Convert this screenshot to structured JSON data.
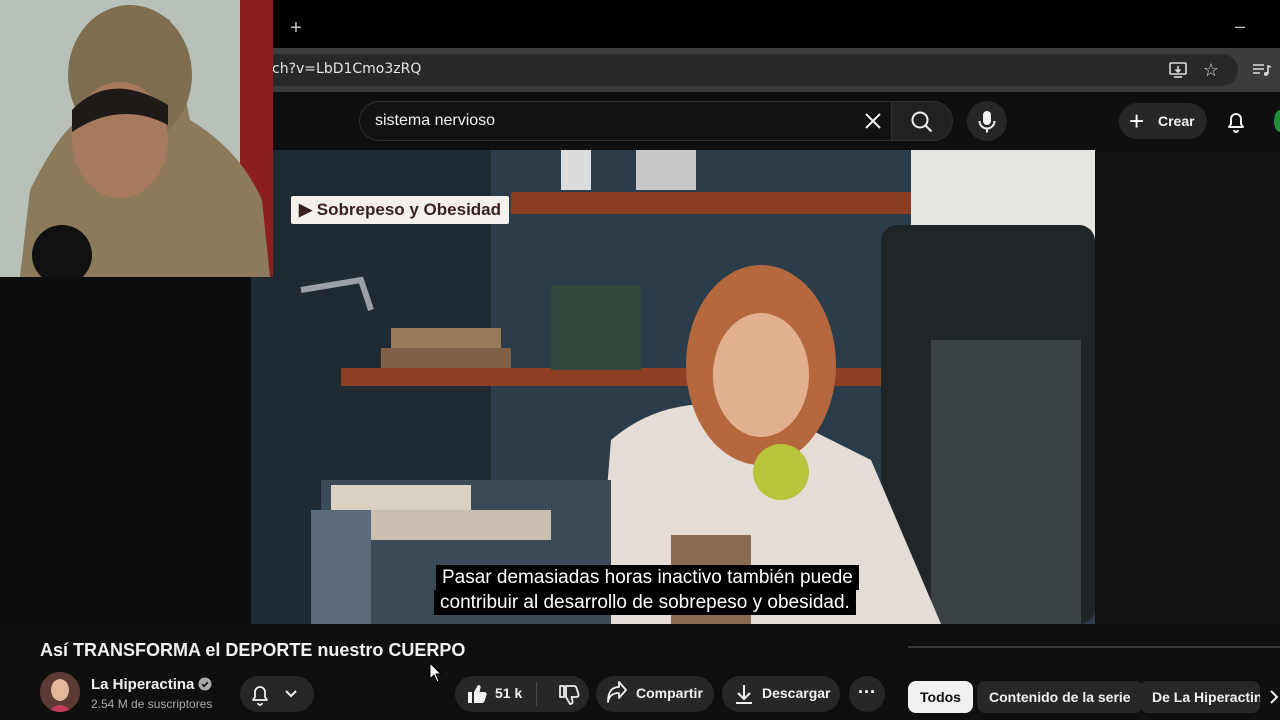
{
  "browser": {
    "new_tab_label": "+",
    "minimize_label": "–",
    "url": "ch?v=LbD1Cmo3zRQ",
    "star_label": "☆"
  },
  "header": {
    "search_value": "sistema nervioso",
    "create_label": "Crear",
    "create_plus": "+"
  },
  "video": {
    "chapter_label": "▶ Sobrepeso y Obesidad",
    "caption_line_1": "Pasar demasiadas horas inactivo también puede",
    "caption_line_2": "contribuir al desarrollo de sobrepeso y obesidad."
  },
  "details": {
    "title": "Así TRANSFORMA el DEPORTE nuestro CUERPO",
    "channel_name": "La Hiperactina",
    "subscribers": "2.54 M de suscriptores",
    "likes": "51 k",
    "share_label": "Compartir",
    "download_label": "Descargar",
    "more_label": "···"
  },
  "chips": [
    "Todos",
    "Contenido de la serie",
    "De La Hiperactina"
  ],
  "colors": {
    "background": "#0f0f0f",
    "button_bg": "#272727",
    "chip_selected": "#f1f1f1",
    "accent_green": "#1f8f3a"
  }
}
